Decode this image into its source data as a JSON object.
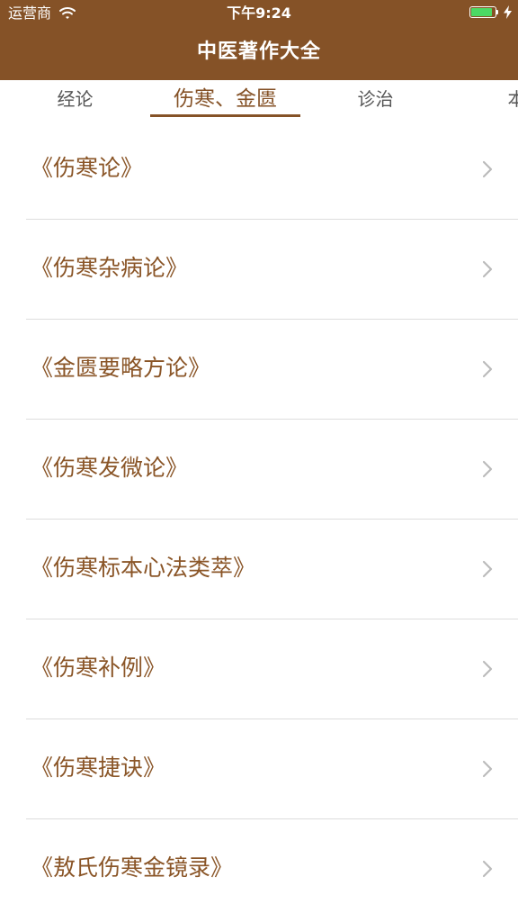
{
  "status_bar": {
    "carrier": "运营商",
    "time": "下午9:24",
    "battery_level": 0.9
  },
  "nav": {
    "title": "中医著作大全"
  },
  "tabs": [
    {
      "label": "经论",
      "active": false
    },
    {
      "label": "伤寒、金匮",
      "active": true
    },
    {
      "label": "诊治",
      "active": false
    },
    {
      "label": "本草",
      "active": false
    }
  ],
  "list": {
    "items": [
      {
        "title": "《伤寒论》"
      },
      {
        "title": "《伤寒杂病论》"
      },
      {
        "title": "《金匮要略方论》"
      },
      {
        "title": "《伤寒发微论》"
      },
      {
        "title": "《伤寒标本心法类萃》"
      },
      {
        "title": "《伤寒补例》"
      },
      {
        "title": "《伤寒捷诀》"
      },
      {
        "title": "《敖氏伤寒金镜录》"
      }
    ]
  },
  "colors": {
    "brand": "#855227",
    "item_text": "#8a5527",
    "tab_text": "#555555",
    "divider": "#dddddd",
    "battery": "#4cd964",
    "chevron": "#bbbbbb"
  },
  "icons": {
    "wifi": "wifi-icon",
    "battery": "battery-icon",
    "charging": "charging-bolt-icon",
    "chevron": "chevron-right-icon"
  }
}
